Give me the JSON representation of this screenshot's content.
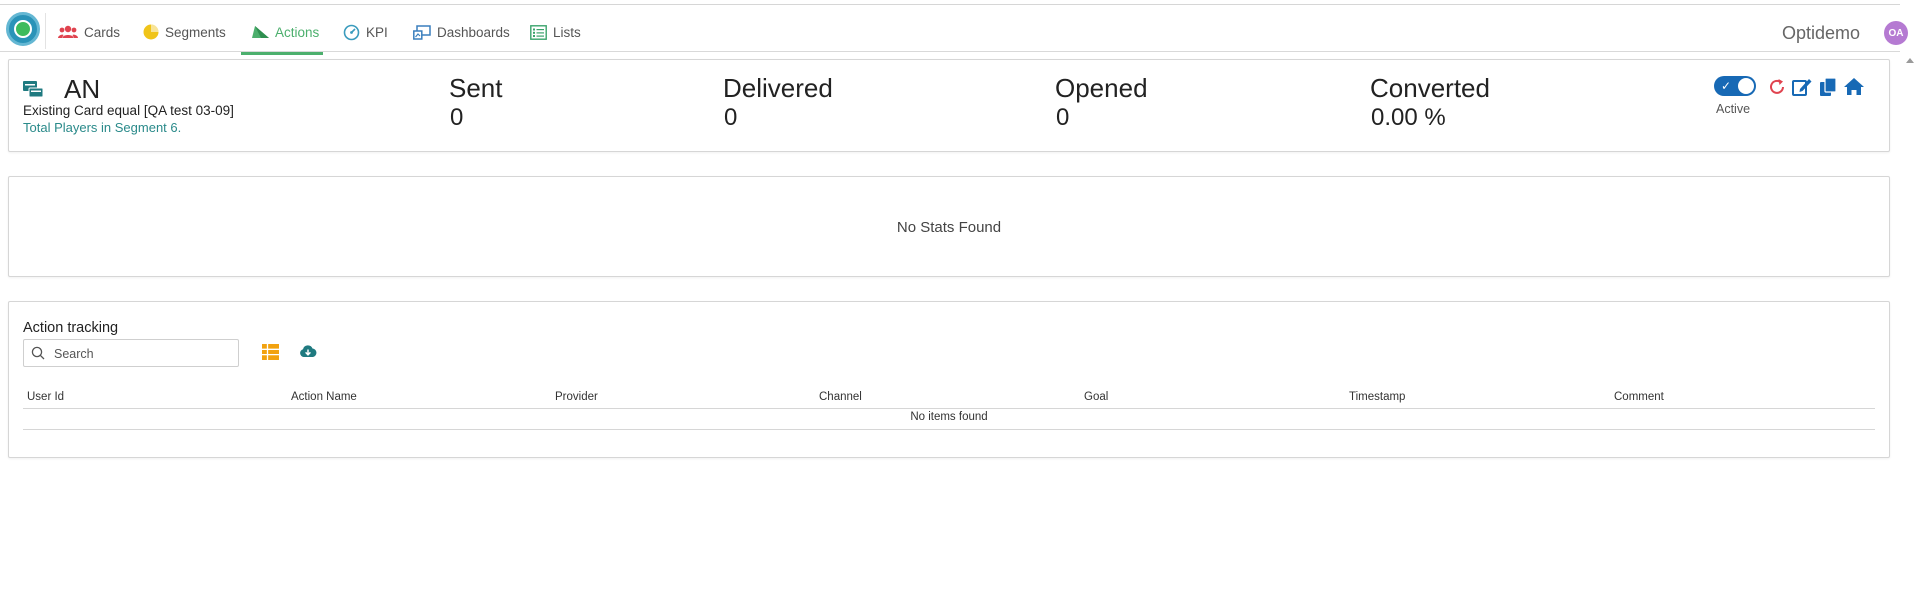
{
  "nav": {
    "items": [
      {
        "label": "Cards",
        "icon": "users-icon",
        "color": "#e0434f"
      },
      {
        "label": "Segments",
        "icon": "pie-chart-icon",
        "color": "#f0c419"
      },
      {
        "label": "Actions",
        "icon": "send-icon",
        "color": "#4caf6d",
        "active": true
      },
      {
        "label": "KPI",
        "icon": "gauge-icon",
        "color": "#3a9bbd"
      },
      {
        "label": "Dashboards",
        "icon": "dashboard-icon",
        "color": "#3a7fbd"
      },
      {
        "label": "Lists",
        "icon": "list-icon",
        "color": "#3aa36b"
      }
    ],
    "brand": "Optidemo",
    "avatar_initials": "OA"
  },
  "summary": {
    "title": "AN",
    "subtitle": "Existing Card equal [QA test 03-09]",
    "link": "Total Players in Segment 6.",
    "metrics": [
      {
        "label": "Sent",
        "value": "0"
      },
      {
        "label": "Delivered",
        "value": "0"
      },
      {
        "label": "Opened",
        "value": "0"
      },
      {
        "label": "Converted",
        "value": "0.00 %"
      }
    ],
    "toggle_label": "Active",
    "toggle_on": true
  },
  "stats": {
    "empty_text": "No Stats Found"
  },
  "tracking": {
    "title": "Action tracking",
    "search_placeholder": "Search",
    "columns": [
      "User Id",
      "Action Name",
      "Provider",
      "Channel",
      "Goal",
      "Timestamp",
      "Comment"
    ],
    "empty_text": "No items found"
  },
  "colors": {
    "accent_green": "#4caf6d",
    "primary_blue": "#1769b5",
    "refresh_red": "#e0434f",
    "teal": "#2a8a8a"
  }
}
